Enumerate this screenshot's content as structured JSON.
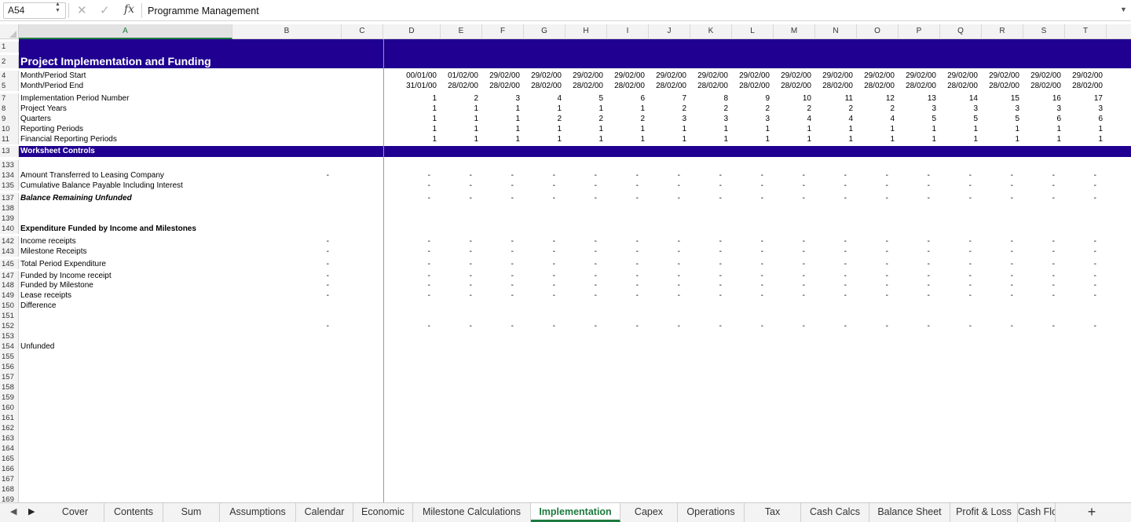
{
  "formula_bar": {
    "cell_ref": "A54",
    "formula": "Programme Management",
    "cancel_glyph": "✕",
    "confirm_glyph": "✓",
    "fx_label": "fx"
  },
  "columns": [
    "A",
    "B",
    "C",
    "D",
    "E",
    "F",
    "G",
    "H",
    "I",
    "J",
    "K",
    "L",
    "M",
    "N",
    "O",
    "P",
    "Q",
    "R",
    "S",
    "T"
  ],
  "selected_column": "A",
  "title": "Project Implementation and Funding",
  "timeline_rows": [
    {
      "row": "4",
      "label": "Month/Period Start",
      "values": [
        "00/01/00",
        "01/02/00",
        "29/02/00",
        "29/02/00",
        "29/02/00",
        "29/02/00",
        "29/02/00",
        "29/02/00",
        "29/02/00",
        "29/02/00",
        "29/02/00",
        "29/02/00",
        "29/02/00",
        "29/02/00",
        "29/02/00",
        "29/02/00",
        "29/02/00"
      ]
    },
    {
      "row": "5",
      "label": "Month/Period End",
      "values": [
        "31/01/00",
        "28/02/00",
        "28/02/00",
        "28/02/00",
        "28/02/00",
        "28/02/00",
        "28/02/00",
        "28/02/00",
        "28/02/00",
        "28/02/00",
        "28/02/00",
        "28/02/00",
        "28/02/00",
        "28/02/00",
        "28/02/00",
        "28/02/00",
        "28/02/00"
      ]
    },
    {
      "row": "7",
      "label": "Implementation Period Number",
      "values": [
        "1",
        "2",
        "3",
        "4",
        "5",
        "6",
        "7",
        "8",
        "9",
        "10",
        "11",
        "12",
        "13",
        "14",
        "15",
        "16",
        "17"
      ]
    },
    {
      "row": "8",
      "label": "Project Years",
      "values": [
        "1",
        "1",
        "1",
        "1",
        "1",
        "1",
        "2",
        "2",
        "2",
        "2",
        "2",
        "2",
        "3",
        "3",
        "3",
        "3",
        "3"
      ]
    },
    {
      "row": "9",
      "label": "Quarters",
      "values": [
        "1",
        "1",
        "1",
        "2",
        "2",
        "2",
        "3",
        "3",
        "3",
        "4",
        "4",
        "4",
        "5",
        "5",
        "5",
        "6",
        "6"
      ]
    },
    {
      "row": "10",
      "label": "Reporting Periods",
      "values": [
        "1",
        "1",
        "1",
        "1",
        "1",
        "1",
        "1",
        "1",
        "1",
        "1",
        "1",
        "1",
        "1",
        "1",
        "1",
        "1",
        "1"
      ]
    },
    {
      "row": "11",
      "label": "Financial Reporting Periods",
      "values": [
        "1",
        "1",
        "1",
        "1",
        "1",
        "1",
        "1",
        "1",
        "1",
        "1",
        "1",
        "1",
        "1",
        "1",
        "1",
        "1",
        "1"
      ]
    }
  ],
  "controls_label": "Worksheet Controls",
  "body_rows": [
    {
      "row": "133",
      "label": "",
      "bold": false,
      "b": "",
      "dashes": false
    },
    {
      "row": "134",
      "label": "Amount Transferred to Leasing Company",
      "bold": false,
      "b": "-",
      "dashes": true
    },
    {
      "row": "135",
      "label": "Cumulative Balance Payable Including Interest",
      "bold": false,
      "b": "",
      "dashes": true
    },
    {
      "row": "137",
      "label": "Balance Remaining Unfunded",
      "bold": true,
      "italic": true,
      "b": "",
      "dashes": true
    },
    {
      "row": "138",
      "label": "",
      "bold": false,
      "b": "",
      "dashes": false
    },
    {
      "row": "139",
      "label": "",
      "bold": false,
      "b": "",
      "dashes": false
    },
    {
      "row": "140",
      "label": "Expenditure Funded by Income and Milestones",
      "bold": true,
      "b": "",
      "dashes": false
    },
    {
      "row": "142",
      "label": "Income receipts",
      "bold": false,
      "b": "-",
      "dashes": true
    },
    {
      "row": "143",
      "label": "Milestone Receipts",
      "bold": false,
      "b": "-",
      "dashes": true
    },
    {
      "row": "145",
      "label": "Total Period Expenditure",
      "bold": false,
      "b": "-",
      "dashes": true
    },
    {
      "row": "147",
      "label": "Funded by Income receipt",
      "bold": false,
      "b": "-",
      "dashes": true
    },
    {
      "row": "148",
      "label": "Funded by Milestone",
      "bold": false,
      "b": "-",
      "dashes": true
    },
    {
      "row": "149",
      "label": "Lease receipts",
      "bold": false,
      "b": "-",
      "dashes": true
    },
    {
      "row": "150",
      "label": "Difference",
      "bold": false,
      "b": "",
      "dashes": false
    },
    {
      "row": "151",
      "label": "",
      "bold": false,
      "b": "",
      "dashes": false
    },
    {
      "row": "152",
      "label": "",
      "bold": false,
      "b": "-",
      "dashes": true
    },
    {
      "row": "153",
      "label": "",
      "bold": false,
      "b": "",
      "dashes": false
    },
    {
      "row": "154",
      "label": "Unfunded",
      "bold": false,
      "b": "",
      "dashes": false
    },
    {
      "row": "155",
      "label": "",
      "bold": false,
      "b": "",
      "dashes": false
    },
    {
      "row": "156",
      "label": "",
      "bold": false,
      "b": "",
      "dashes": false
    },
    {
      "row": "157",
      "label": "",
      "bold": false,
      "b": "",
      "dashes": false
    },
    {
      "row": "158",
      "label": "",
      "bold": false,
      "b": "",
      "dashes": false
    },
    {
      "row": "159",
      "label": "",
      "bold": false,
      "b": "",
      "dashes": false
    },
    {
      "row": "160",
      "label": "",
      "bold": false,
      "b": "",
      "dashes": false
    },
    {
      "row": "161",
      "label": "",
      "bold": false,
      "b": "",
      "dashes": false
    },
    {
      "row": "162",
      "label": "",
      "bold": false,
      "b": "",
      "dashes": false
    },
    {
      "row": "163",
      "label": "",
      "bold": false,
      "b": "",
      "dashes": false
    },
    {
      "row": "164",
      "label": "",
      "bold": false,
      "b": "",
      "dashes": false
    },
    {
      "row": "165",
      "label": "",
      "bold": false,
      "b": "",
      "dashes": false
    },
    {
      "row": "166",
      "label": "",
      "bold": false,
      "b": "",
      "dashes": false
    },
    {
      "row": "167",
      "label": "",
      "bold": false,
      "b": "",
      "dashes": false
    },
    {
      "row": "168",
      "label": "",
      "bold": false,
      "b": "",
      "dashes": false
    },
    {
      "row": "169",
      "label": "",
      "bold": false,
      "b": "",
      "dashes": false
    }
  ],
  "dash_glyph": "-",
  "header_band_color": "#1f0090",
  "sheet_tabs": [
    "Cover",
    "Contents",
    "Sum",
    "Assumptions",
    "Calendar",
    "Economic",
    "Milestone Calculations",
    "Implementation",
    "Capex",
    "Operations",
    "Tax",
    "Cash Calcs",
    "Balance Sheet",
    "Profit & Loss",
    "Cash Flo"
  ],
  "active_tab": "Implementation",
  "add_sheet_glyph": "+"
}
